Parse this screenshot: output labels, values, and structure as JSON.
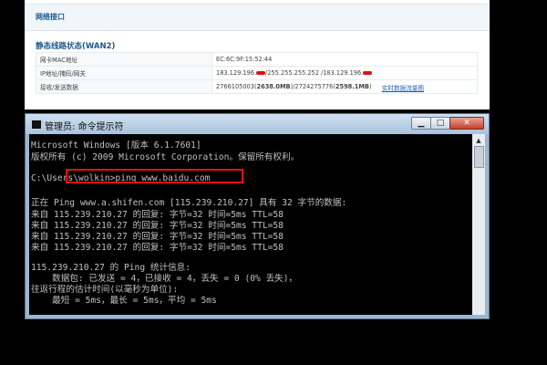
{
  "router": {
    "header": "网络接口",
    "section_title": "静态线路状态(WAN2)",
    "rows": [
      {
        "label": "网卡MAC地址",
        "value": "EC:6C:9F:15:52:44"
      },
      {
        "label": "IP地址/掩码/网关",
        "value_a": "183.129.196.",
        "value_b": "/255.255.255.252 /183.129.196.",
        "redacted": true
      },
      {
        "label": "接收/发送数据",
        "value_plain_1": "2766105003(",
        "value_bold_1": "2638.0MB",
        "value_plain_2": ")/2724275776(",
        "value_bold_2": "2598.1MB",
        "value_plain_3": ")",
        "link": "实时数据流量图"
      }
    ],
    "redact_color": "#e01010"
  },
  "cmd": {
    "title": "管理员: 命令提示符",
    "buttons": {
      "minimize": "▁",
      "maximize": "□",
      "close": "✕"
    },
    "lines": [
      "Microsoft Windows [版本 6.1.7601]",
      "版权所有 (c) 2009 Microsoft Corporation。保留所有权利。",
      "",
      "C:\\Users\\wolkin>ping www.baidu.com",
      "",
      "正在 Ping www.a.shifen.com [115.239.210.27] 具有 32 字节的数据:",
      "来自 115.239.210.27 的回复: 字节=32 时间=5ms TTL=58",
      "来自 115.239.210.27 的回复: 字节=32 时间=5ms TTL=58",
      "来自 115.239.210.27 的回复: 字节=32 时间=5ms TTL=58",
      "来自 115.239.210.27 的回复: 字节=32 时间=5ms TTL=58",
      "",
      "115.239.210.27 的 Ping 统计信息:",
      "    数据包: 已发送 = 4，已接收 = 4，丢失 = 0 (0% 丢失)，",
      "往返行程的估计时间(以毫秒为单位):",
      "    最短 = 5ms，最长 = 5ms，平均 = 5ms"
    ],
    "highlight_color": "#e81010"
  }
}
